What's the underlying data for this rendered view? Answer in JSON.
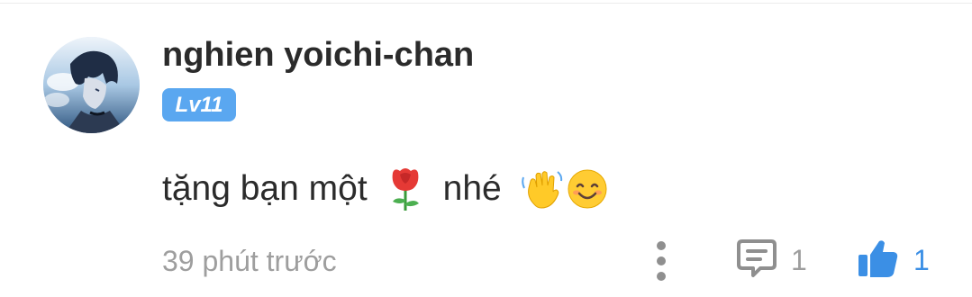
{
  "comment": {
    "username": "nghien yoichi-chan",
    "level": "Lv11",
    "text_before": "tặng bạn một",
    "text_after": "nhé",
    "emojis": [
      "rose-emoji",
      "waving-hand-emoji",
      "smiling-face-emoji"
    ],
    "timestamp": "39 phút trước",
    "reply_count": "1",
    "like_count": "1",
    "icons": {
      "more": "more-vertical-icon",
      "reply": "comment-icon",
      "like": "thumbs-up-icon"
    },
    "colors": {
      "badge": "#5aa7f0",
      "like_active": "#3b8fe5",
      "muted": "#9e9e9e",
      "text": "#2b2b2b"
    }
  }
}
